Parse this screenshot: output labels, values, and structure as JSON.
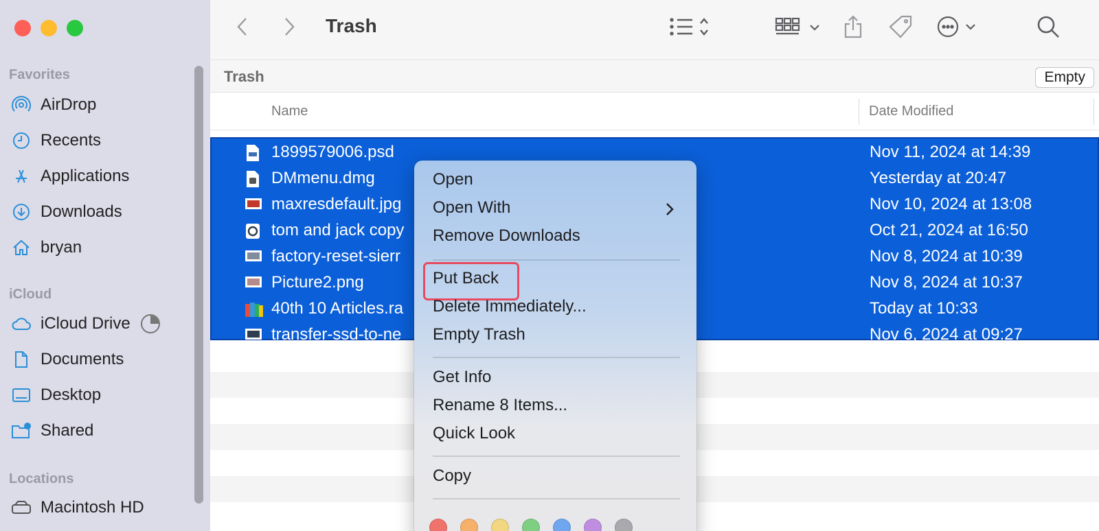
{
  "window": {
    "title": "Trash"
  },
  "sidebar": {
    "favorites_header": "Favorites",
    "favorites": [
      {
        "label": "AirDrop",
        "icon": "airdrop-icon"
      },
      {
        "label": "Recents",
        "icon": "clock-icon"
      },
      {
        "label": "Applications",
        "icon": "applications-icon"
      },
      {
        "label": "Downloads",
        "icon": "download-icon"
      },
      {
        "label": "bryan",
        "icon": "home-icon"
      }
    ],
    "icloud_header": "iCloud",
    "icloud": [
      {
        "label": "iCloud Drive",
        "icon": "cloud-icon"
      },
      {
        "label": "Documents",
        "icon": "document-icon"
      },
      {
        "label": "Desktop",
        "icon": "desktop-icon"
      },
      {
        "label": "Shared",
        "icon": "shared-folder-icon"
      }
    ],
    "locations_header": "Locations",
    "locations": [
      {
        "label": "Macintosh HD",
        "icon": "disk-icon"
      }
    ]
  },
  "pathbar": {
    "label": "Trash",
    "empty_button": "Empty"
  },
  "columns": {
    "name": "Name",
    "date_modified": "Date Modified"
  },
  "files": [
    {
      "name": "1899579006.psd",
      "date": "Nov 11, 2024 at 14:39"
    },
    {
      "name": "DMmenu.dmg",
      "date": "Yesterday at 20:47"
    },
    {
      "name": "maxresdefault.jpg",
      "date": "Nov 10, 2024 at 13:08"
    },
    {
      "name": "tom and jack copy",
      "date": "Oct 21, 2024 at 16:50"
    },
    {
      "name": "factory-reset-sierr",
      "date": "Nov 8, 2024 at 10:39"
    },
    {
      "name": "Picture2.png",
      "date": "Nov 8, 2024 at 10:37"
    },
    {
      "name": "40th 10 Articles.ra",
      "date": "Today at 10:33"
    },
    {
      "name": "transfer-ssd-to-ne",
      "date": "Nov 6, 2024 at 09:27"
    }
  ],
  "context_menu": {
    "open": "Open",
    "open_with": "Open With",
    "remove_downloads": "Remove Downloads",
    "put_back": "Put Back",
    "delete_immediately": "Delete Immediately...",
    "empty_trash": "Empty Trash",
    "get_info": "Get Info",
    "rename": "Rename 8 Items...",
    "quick_look": "Quick Look",
    "copy": "Copy",
    "tag_colors": [
      "#f0736b",
      "#f5b06a",
      "#f2d680",
      "#7fcf83",
      "#6fa6ee",
      "#c08ee0",
      "#a9a9ae"
    ]
  },
  "colors": {
    "selection": "#0b5fd8",
    "highlight": "#e84a5f",
    "sidebar": "#dcdbe8"
  }
}
